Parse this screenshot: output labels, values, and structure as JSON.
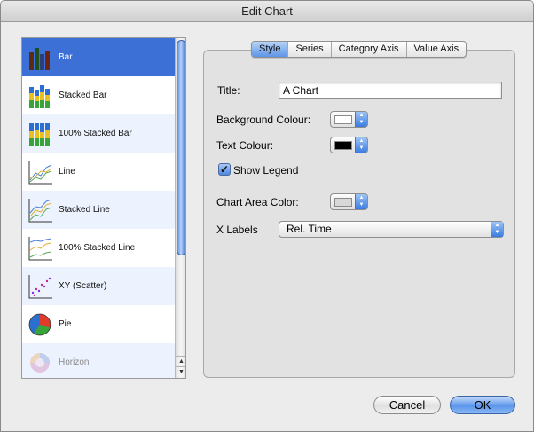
{
  "window": {
    "title": "Edit Chart"
  },
  "chart_types": [
    {
      "label": "Bar",
      "icon": "bar-chart-icon",
      "selected": true
    },
    {
      "label": "Stacked Bar",
      "icon": "stacked-bar-chart-icon"
    },
    {
      "label": "100% Stacked Bar",
      "icon": "percent-stacked-bar-chart-icon"
    },
    {
      "label": "Line",
      "icon": "line-chart-icon"
    },
    {
      "label": "Stacked Line",
      "icon": "stacked-line-chart-icon"
    },
    {
      "label": "100% Stacked Line",
      "icon": "percent-stacked-line-chart-icon"
    },
    {
      "label": "XY (Scatter)",
      "icon": "scatter-chart-icon"
    },
    {
      "label": "Pie",
      "icon": "pie-chart-icon"
    },
    {
      "label": "Horizon",
      "icon": "horizon-chart-icon",
      "disabled": true
    }
  ],
  "tabs": [
    {
      "label": "Style",
      "active": true
    },
    {
      "label": "Series"
    },
    {
      "label": "Category Axis"
    },
    {
      "label": "Value Axis"
    }
  ],
  "style": {
    "title_label": "Title:",
    "title_value": "A Chart",
    "background_colour_label": "Background Colour:",
    "background_colour": "#ffffff",
    "text_colour_label": "Text Colour:",
    "text_colour": "#000000",
    "show_legend_label": "Show Legend",
    "show_legend_checked": true,
    "chart_area_color_label": "Chart Area Color:",
    "chart_area_color": "#d8d8d8",
    "x_labels_label": "X Labels",
    "x_labels_value": "Rel. Time"
  },
  "buttons": {
    "cancel": "Cancel",
    "ok": "OK"
  },
  "colors": {
    "accent": "#3d70d6",
    "selection": "#3d70d6"
  }
}
